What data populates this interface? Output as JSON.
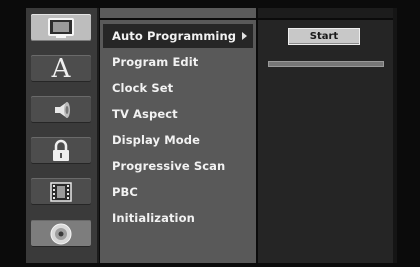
{
  "icons": [
    {
      "name": "tv-icon",
      "selected": true
    },
    {
      "name": "language-a-icon",
      "glyph": "A"
    },
    {
      "name": "speaker-icon"
    },
    {
      "name": "lock-icon"
    },
    {
      "name": "film-icon"
    },
    {
      "name": "disc-icon"
    }
  ],
  "menu": {
    "items": [
      {
        "label": "Auto Programming",
        "selected": true,
        "has_arrow": true
      },
      {
        "label": "Program Edit"
      },
      {
        "label": "Clock Set"
      },
      {
        "label": "TV Aspect"
      },
      {
        "label": "Display Mode"
      },
      {
        "label": "Progressive Scan"
      },
      {
        "label": "PBC"
      },
      {
        "label": "Initialization"
      }
    ]
  },
  "panel": {
    "start_label": "Start",
    "progress": 0
  }
}
